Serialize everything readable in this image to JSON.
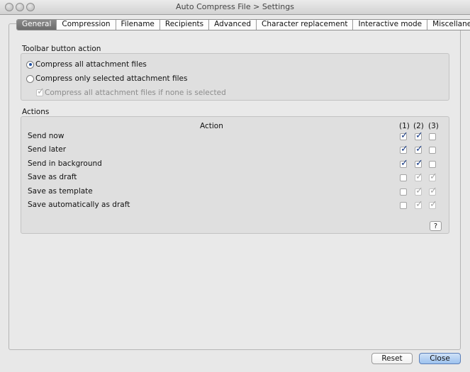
{
  "window": {
    "title": "Auto Compress File > Settings"
  },
  "tabs": [
    "General",
    "Compression",
    "Filename",
    "Recipients",
    "Advanced",
    "Character replacement",
    "Interactive mode",
    "Miscellaneous"
  ],
  "toolbar_section": {
    "label": "Toolbar button action",
    "option_all": "Compress all attachment files",
    "option_selected": "Compress only selected attachment files",
    "sub_option": "Compress all attachment files if none is selected"
  },
  "actions_section": {
    "label": "Actions",
    "column_action": "Action",
    "col1": "(1)",
    "col2": "(2)",
    "col3": "(3)",
    "rows": [
      {
        "label": "Send now",
        "c1": true,
        "c2": true,
        "c3": false,
        "dim": false
      },
      {
        "label": "Send later",
        "c1": true,
        "c2": true,
        "c3": false,
        "dim": false
      },
      {
        "label": "Send in background",
        "c1": true,
        "c2": true,
        "c3": false,
        "dim": false
      },
      {
        "label": "Save as draft",
        "c1": false,
        "c2": true,
        "c3": true,
        "dim": true
      },
      {
        "label": "Save as template",
        "c1": false,
        "c2": true,
        "c3": true,
        "dim": true
      },
      {
        "label": "Save automatically as draft",
        "c1": false,
        "c2": true,
        "c3": true,
        "dim": true
      }
    ],
    "help_label": "?"
  },
  "footer": {
    "reset_label": "Reset",
    "close_label": "Close"
  }
}
